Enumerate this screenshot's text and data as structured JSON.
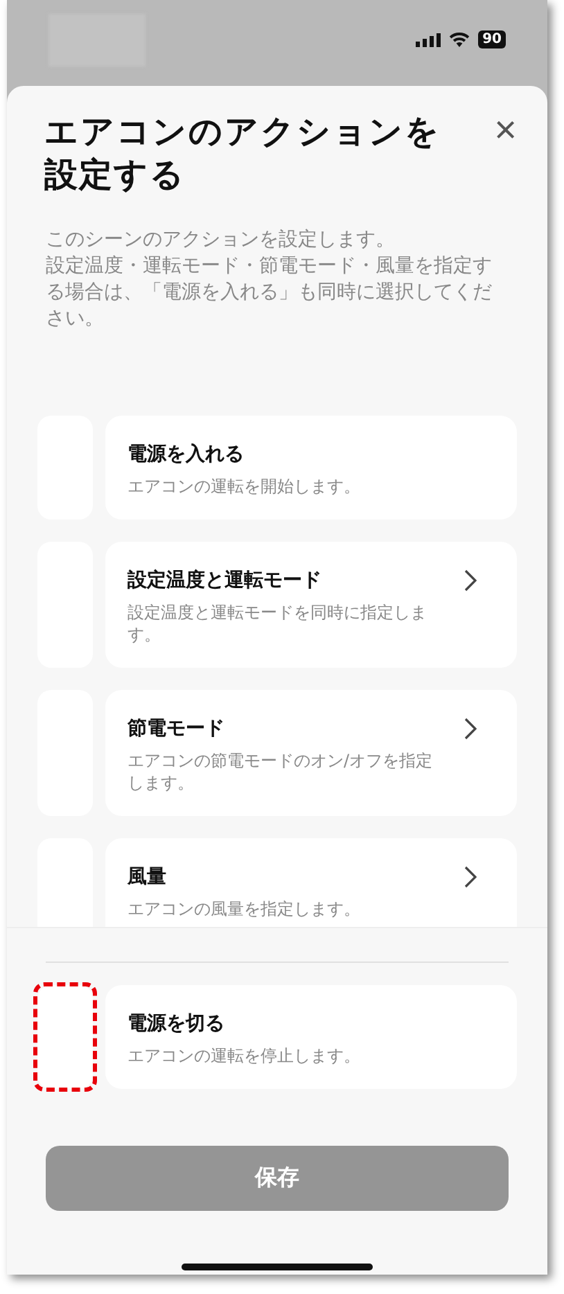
{
  "status_bar": {
    "battery": "90"
  },
  "sheet": {
    "title": "エアコンのアクションを設定する",
    "close": "×",
    "description": [
      "このシーンのアクションを設定します。",
      "設定温度・運転モード・節電モード・風量を指定する場合は、「電源を入れる」も同時に選択してください。"
    ]
  },
  "actions": [
    {
      "title": "電源を入れる",
      "subtitle": "エアコンの運転を開始します。",
      "chevron": false
    },
    {
      "title": "設定温度と運転モード",
      "subtitle": "設定温度と運転モードを同時に指定します。",
      "chevron": true
    },
    {
      "title": "節電モード",
      "subtitle": "エアコンの節電モードのオン/オフを指定します。",
      "chevron": true
    },
    {
      "title": "風量",
      "subtitle": "エアコンの風量を指定します。",
      "chevron": true
    }
  ],
  "footer_action": {
    "title": "電源を切る",
    "subtitle": "エアコンの運転を停止します。",
    "chevron": false,
    "highlighted": true
  },
  "save_button": {
    "label": "保存",
    "disabled": true
  }
}
